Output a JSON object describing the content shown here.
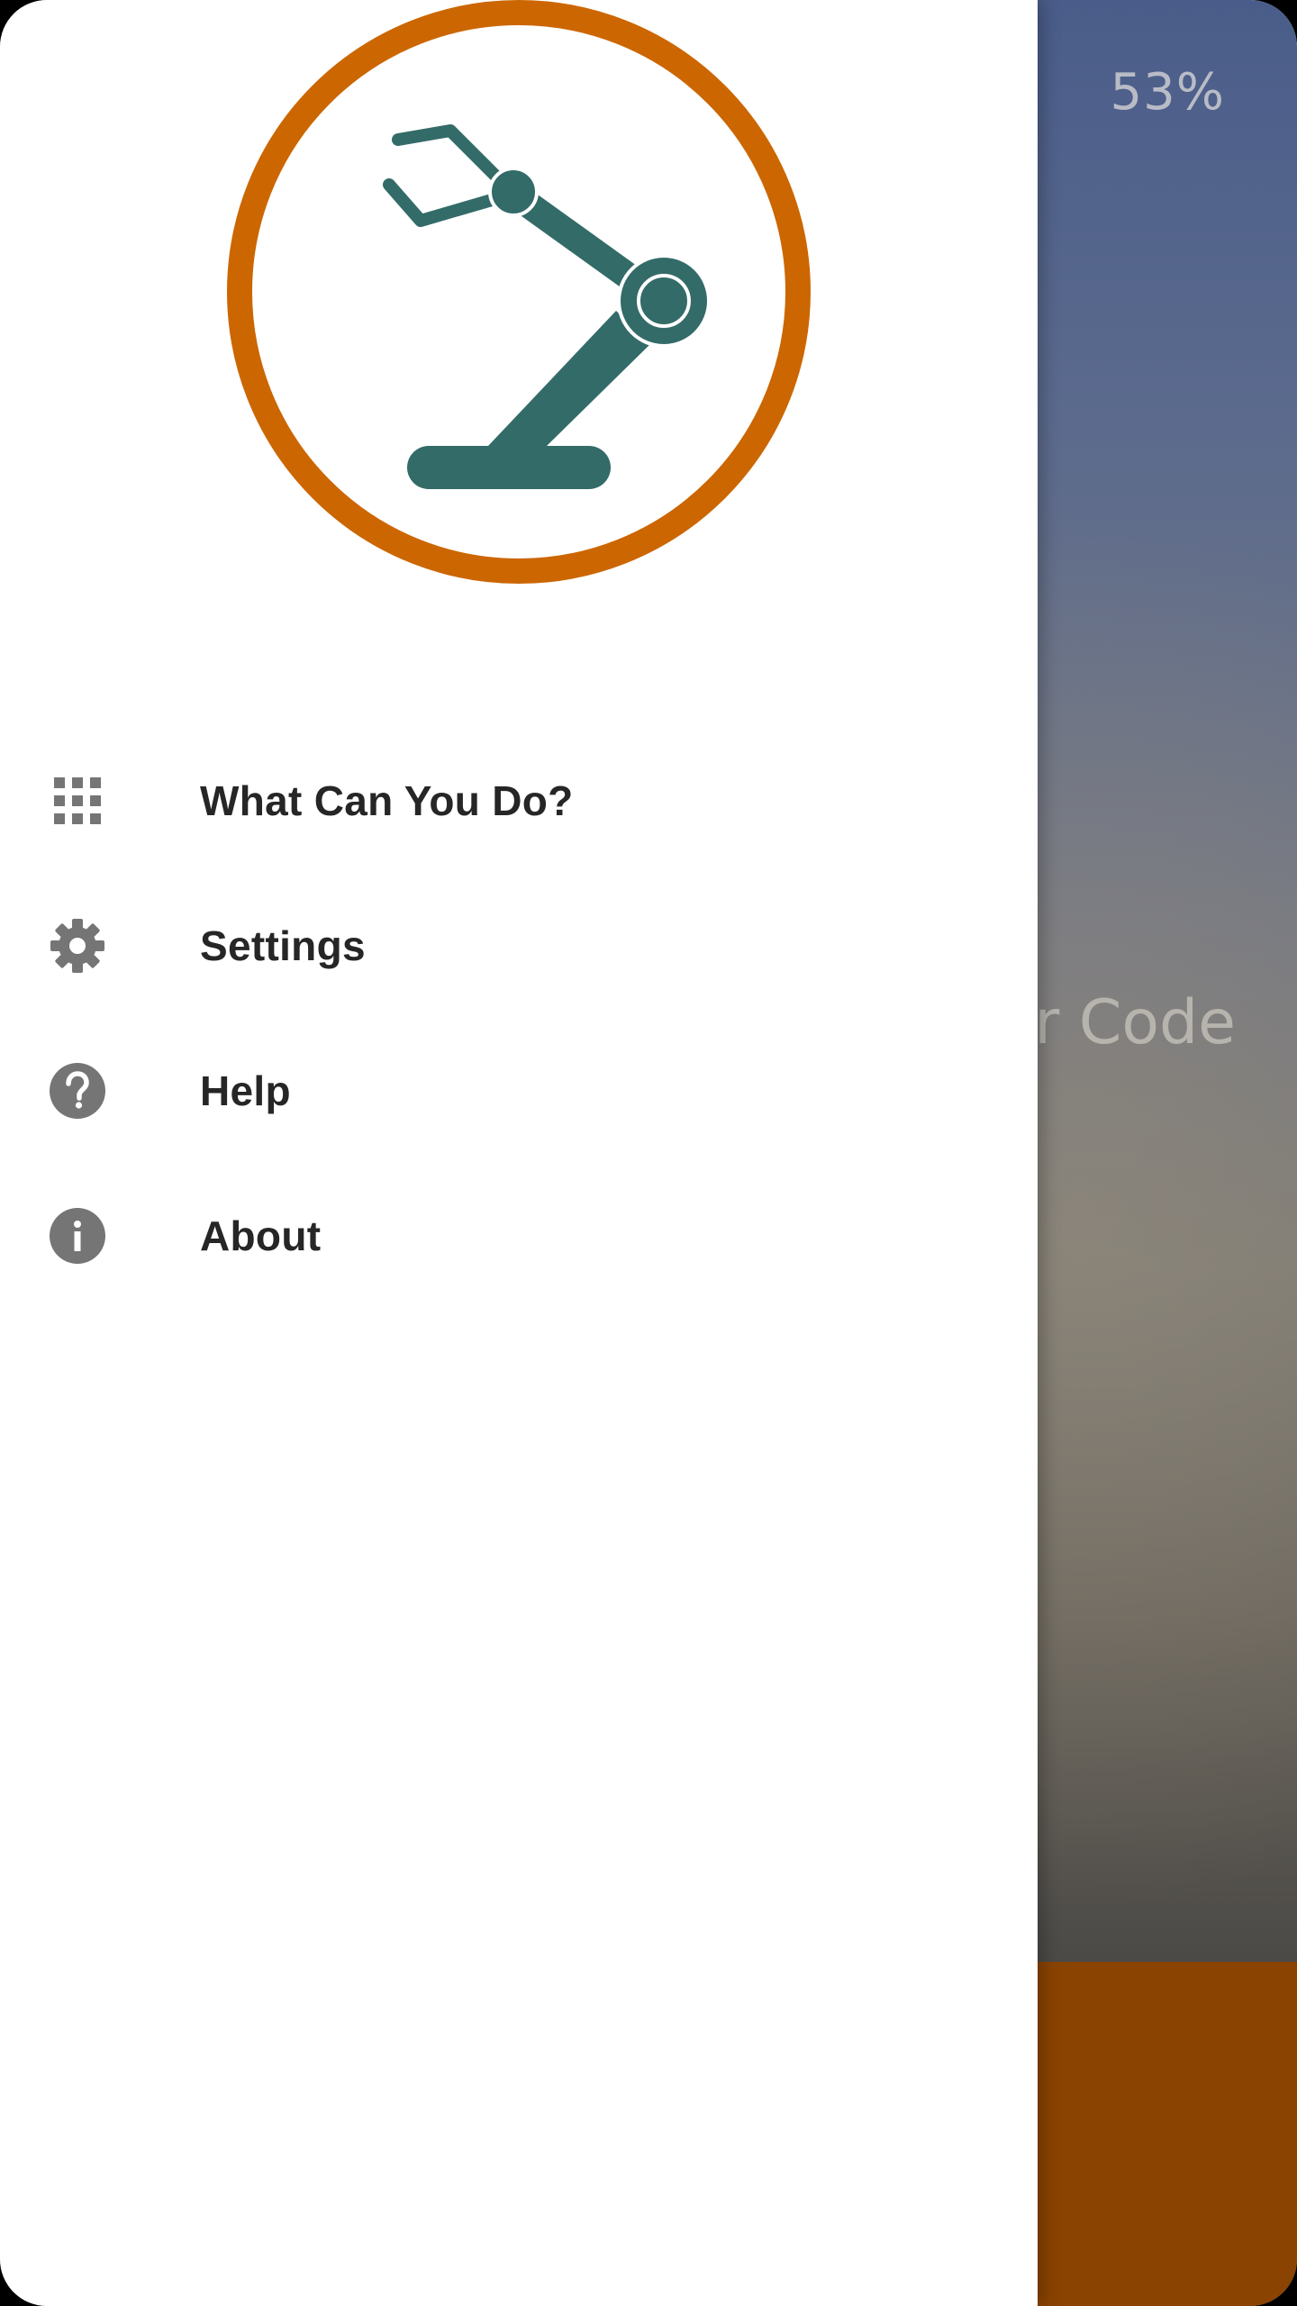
{
  "status": {
    "battery": "53%"
  },
  "background": {
    "partial_text": "r Code",
    "bottom_bar_color": "#8a4301"
  },
  "drawer": {
    "logo": {
      "name": "robot-arm-logo",
      "ring_color": "#cc6600",
      "arm_color": "#336b68"
    },
    "menu": [
      {
        "label": "What Can You Do?",
        "icon": "apps-grid-icon"
      },
      {
        "label": "Settings",
        "icon": "gear-icon"
      },
      {
        "label": "Help",
        "icon": "help-circle-icon"
      },
      {
        "label": "About",
        "icon": "info-icon"
      }
    ]
  },
  "colors": {
    "icon_gray": "#757575",
    "text_dark": "#262626"
  }
}
